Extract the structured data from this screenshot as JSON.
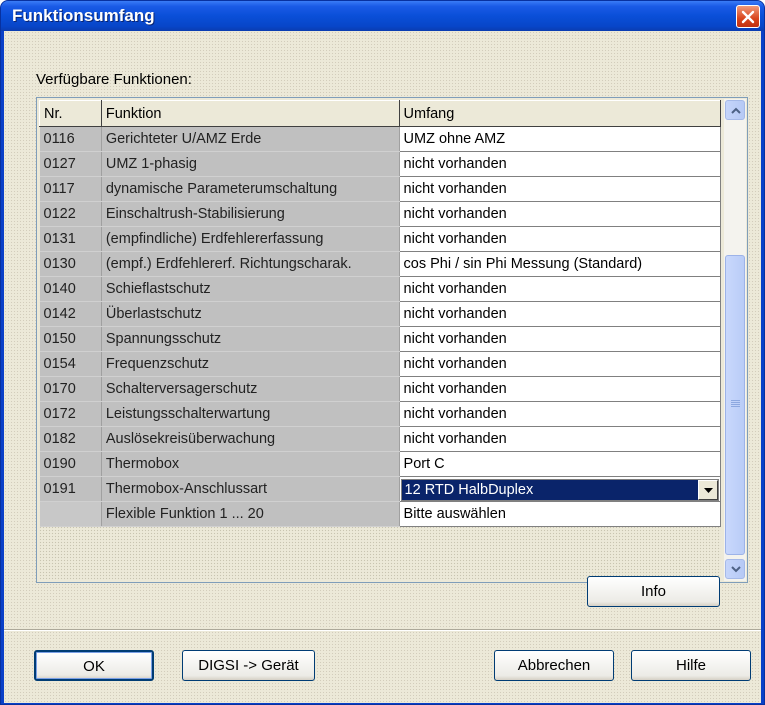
{
  "window": {
    "title": "Funktionsumfang"
  },
  "label_available": "Verfügbare Funktionen:",
  "columns": {
    "nr": "Nr.",
    "funktion": "Funktion",
    "umfang": "Umfang"
  },
  "rows": [
    {
      "nr": "0116",
      "funktion": "Gerichteter U/AMZ Erde",
      "umfang": "UMZ ohne AMZ"
    },
    {
      "nr": "0127",
      "funktion": "UMZ 1-phasig",
      "umfang": "nicht vorhanden"
    },
    {
      "nr": "0117",
      "funktion": "dynamische Parameterumschaltung",
      "umfang": "nicht vorhanden"
    },
    {
      "nr": "0122",
      "funktion": "Einschaltrush-Stabilisierung",
      "umfang": "nicht vorhanden"
    },
    {
      "nr": "0131",
      "funktion": "(empfindliche) Erdfehlererfassung",
      "umfang": "nicht vorhanden"
    },
    {
      "nr": "0130",
      "funktion": "(empf.) Erdfehlererf. Richtungscharak.",
      "umfang": "cos Phi / sin Phi Messung (Standard)"
    },
    {
      "nr": "0140",
      "funktion": "Schieflastschutz",
      "umfang": "nicht vorhanden"
    },
    {
      "nr": "0142",
      "funktion": "Überlastschutz",
      "umfang": "nicht vorhanden"
    },
    {
      "nr": "0150",
      "funktion": "Spannungsschutz",
      "umfang": "nicht vorhanden"
    },
    {
      "nr": "0154",
      "funktion": "Frequenzschutz",
      "umfang": "nicht vorhanden"
    },
    {
      "nr": "0170",
      "funktion": "Schalterversagerschutz",
      "umfang": "nicht vorhanden"
    },
    {
      "nr": "0172",
      "funktion": "Leistungsschalterwartung",
      "umfang": "nicht vorhanden"
    },
    {
      "nr": "0182",
      "funktion": "Auslösekreisüberwachung",
      "umfang": "nicht vorhanden"
    },
    {
      "nr": "0190",
      "funktion": "Thermobox",
      "umfang": "Port C"
    },
    {
      "nr": "0191",
      "funktion": "Thermobox-Anschlussart",
      "umfang": "12 RTD HalbDuplex",
      "dropdown": true
    },
    {
      "nr": "",
      "funktion": "Flexible Funktion 1 ... 20",
      "umfang": "Bitte auswählen"
    }
  ],
  "buttons": {
    "info": "Info",
    "ok": "OK",
    "digsi": "DIGSI -> Gerät",
    "abbrechen": "Abbrechen",
    "hilfe": "Hilfe"
  },
  "icons": {
    "close": "close-icon",
    "scroll_up": "chevron-up-icon",
    "scroll_down": "chevron-down-icon",
    "dropdown": "chevron-down-icon"
  }
}
